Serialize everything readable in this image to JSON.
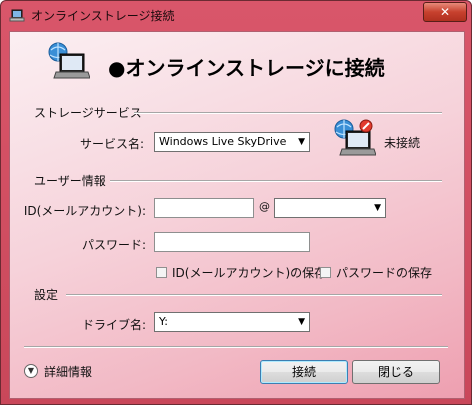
{
  "window": {
    "title": "オンラインストレージ接続",
    "close_label": "✕"
  },
  "header": {
    "title": "●オンラインストレージに接続"
  },
  "storage_section": {
    "label": "ストレージサービス",
    "service_label": "サービス名:",
    "service_value": "Windows Live SkyDrive",
    "status": "未接続"
  },
  "user_section": {
    "label": "ユーザー情報",
    "id_label": "ID(メールアカウント):",
    "id_value": "",
    "at_sign": "@",
    "domain_value": "",
    "password_label": "パスワード:",
    "password_value": "",
    "save_id_label": "ID(メールアカウント)の保存",
    "save_password_label": "パスワードの保存"
  },
  "settings_section": {
    "label": "設定",
    "drive_label": "ドライブ名:",
    "drive_value": "Y:"
  },
  "footer": {
    "details_label": "詳細情報",
    "connect_label": "接続",
    "close_label": "閉じる"
  },
  "icons": {
    "title_icon": "laptop-icon",
    "header_icon": "laptop-globe-icon",
    "status_icon": "laptop-disconnected-icon",
    "details_icon": "chevron-down-icon"
  },
  "colors": {
    "frame": "#c9475a",
    "client_top": "#fbeff2",
    "client_bottom": "#ee9fb0",
    "close_button": "#c7412e"
  }
}
